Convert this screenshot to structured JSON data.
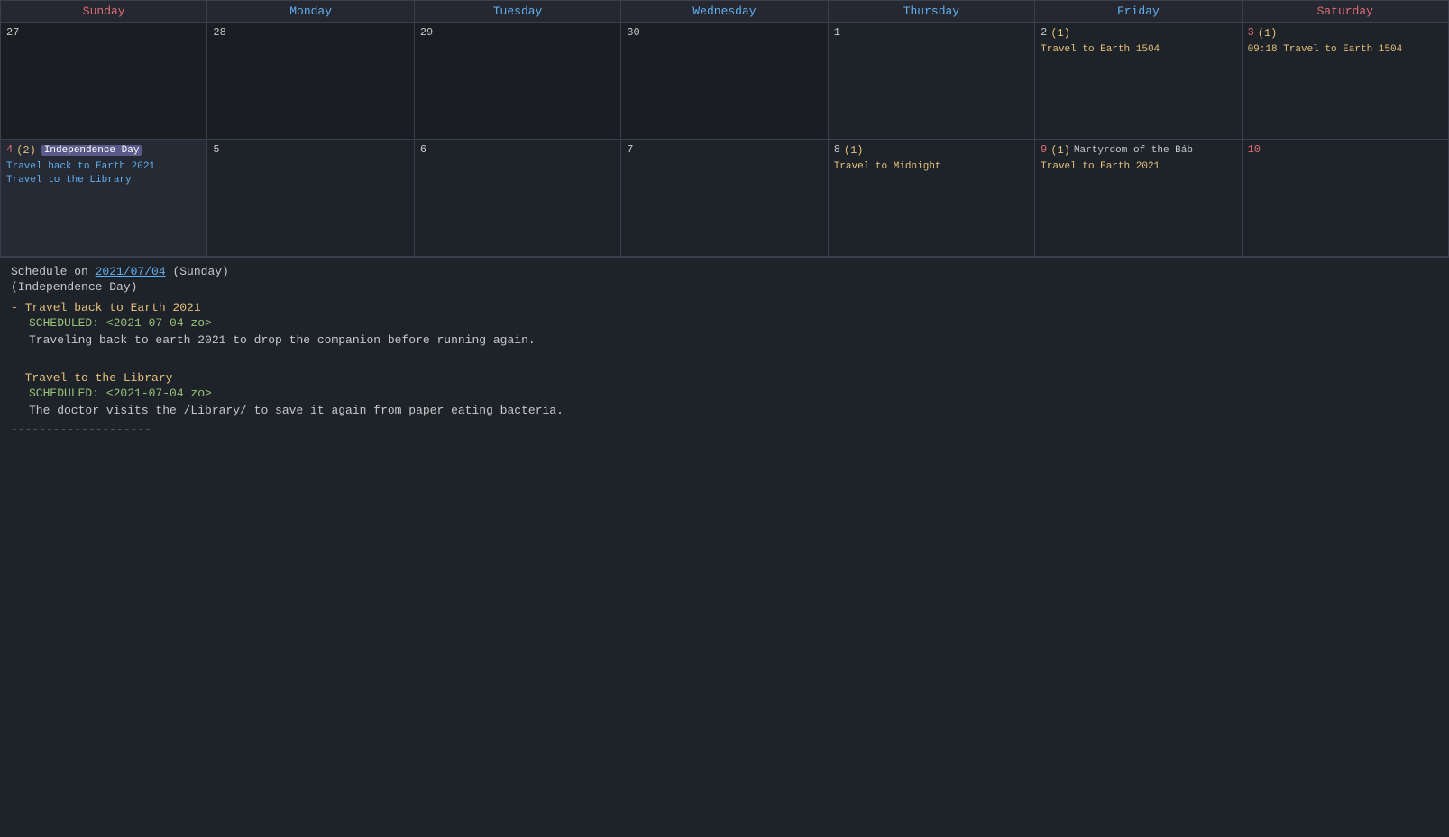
{
  "calendar": {
    "headers": [
      {
        "label": "Sunday",
        "class": "sunday"
      },
      {
        "label": "Monday",
        "class": "monday"
      },
      {
        "label": "Tuesday",
        "class": "tuesday"
      },
      {
        "label": "Wednesday",
        "class": "wednesday"
      },
      {
        "label": "Thursday",
        "class": "thursday"
      },
      {
        "label": "Friday",
        "class": "friday"
      },
      {
        "label": "Saturday",
        "class": "saturday"
      }
    ],
    "rows": [
      [
        {
          "num": "27",
          "otherMonth": true,
          "events": []
        },
        {
          "num": "28",
          "otherMonth": true,
          "events": []
        },
        {
          "num": "29",
          "otherMonth": true,
          "events": []
        },
        {
          "num": "30",
          "otherMonth": true,
          "events": []
        },
        {
          "num": "1",
          "events": []
        },
        {
          "num": "2",
          "eventCount": "(1)",
          "events": [
            {
              "text": "Travel to Earth 1504",
              "color": "orange"
            }
          ]
        },
        {
          "num": "3",
          "eventCount": "(1)",
          "saturday": true,
          "events": [
            {
              "text": "09:18 Travel to Earth 1504",
              "color": "orange"
            }
          ]
        }
      ],
      [
        {
          "num": "4",
          "selected": true,
          "holiday": "Independence Day",
          "eventCount": "(2)",
          "events": [
            {
              "text": "Travel back to Earth 2021",
              "color": "plain"
            },
            {
              "text": "Travel to the Library",
              "color": "plain"
            }
          ]
        },
        {
          "num": "5",
          "events": []
        },
        {
          "num": "6",
          "events": []
        },
        {
          "num": "7",
          "events": []
        },
        {
          "num": "8",
          "eventCount": "(1)",
          "events": [
            {
              "text": "Travel to Midnight",
              "color": "orange"
            }
          ]
        },
        {
          "num": "9",
          "eventCount": "(1)",
          "holiday": "Martyrdom of the Báb",
          "events": [
            {
              "text": "Travel to Earth 2021",
              "color": "orange"
            }
          ]
        },
        {
          "num": "10",
          "saturday": true,
          "events": []
        }
      ]
    ]
  },
  "schedule": {
    "dateText": "Schedule on 2021/07/04",
    "dateLinkText": "2021/07/04",
    "dayText": "(Sunday)",
    "holiday": "(Independence Day)",
    "entries": [
      {
        "title": "- Travel back to Earth 2021",
        "scheduled": "SCHEDULED: <2021-07-04 zo>",
        "desc": "Traveling back to earth 2021 to drop the companion before running again."
      },
      {
        "divider": "--------------------"
      },
      {
        "title": "- Travel to the Library",
        "scheduled": "SCHEDULED: <2021-07-04 zo>",
        "desc": "The doctor visits the /Library/ to save it again from paper eating bacteria."
      },
      {
        "divider": "--------------------"
      }
    ]
  }
}
